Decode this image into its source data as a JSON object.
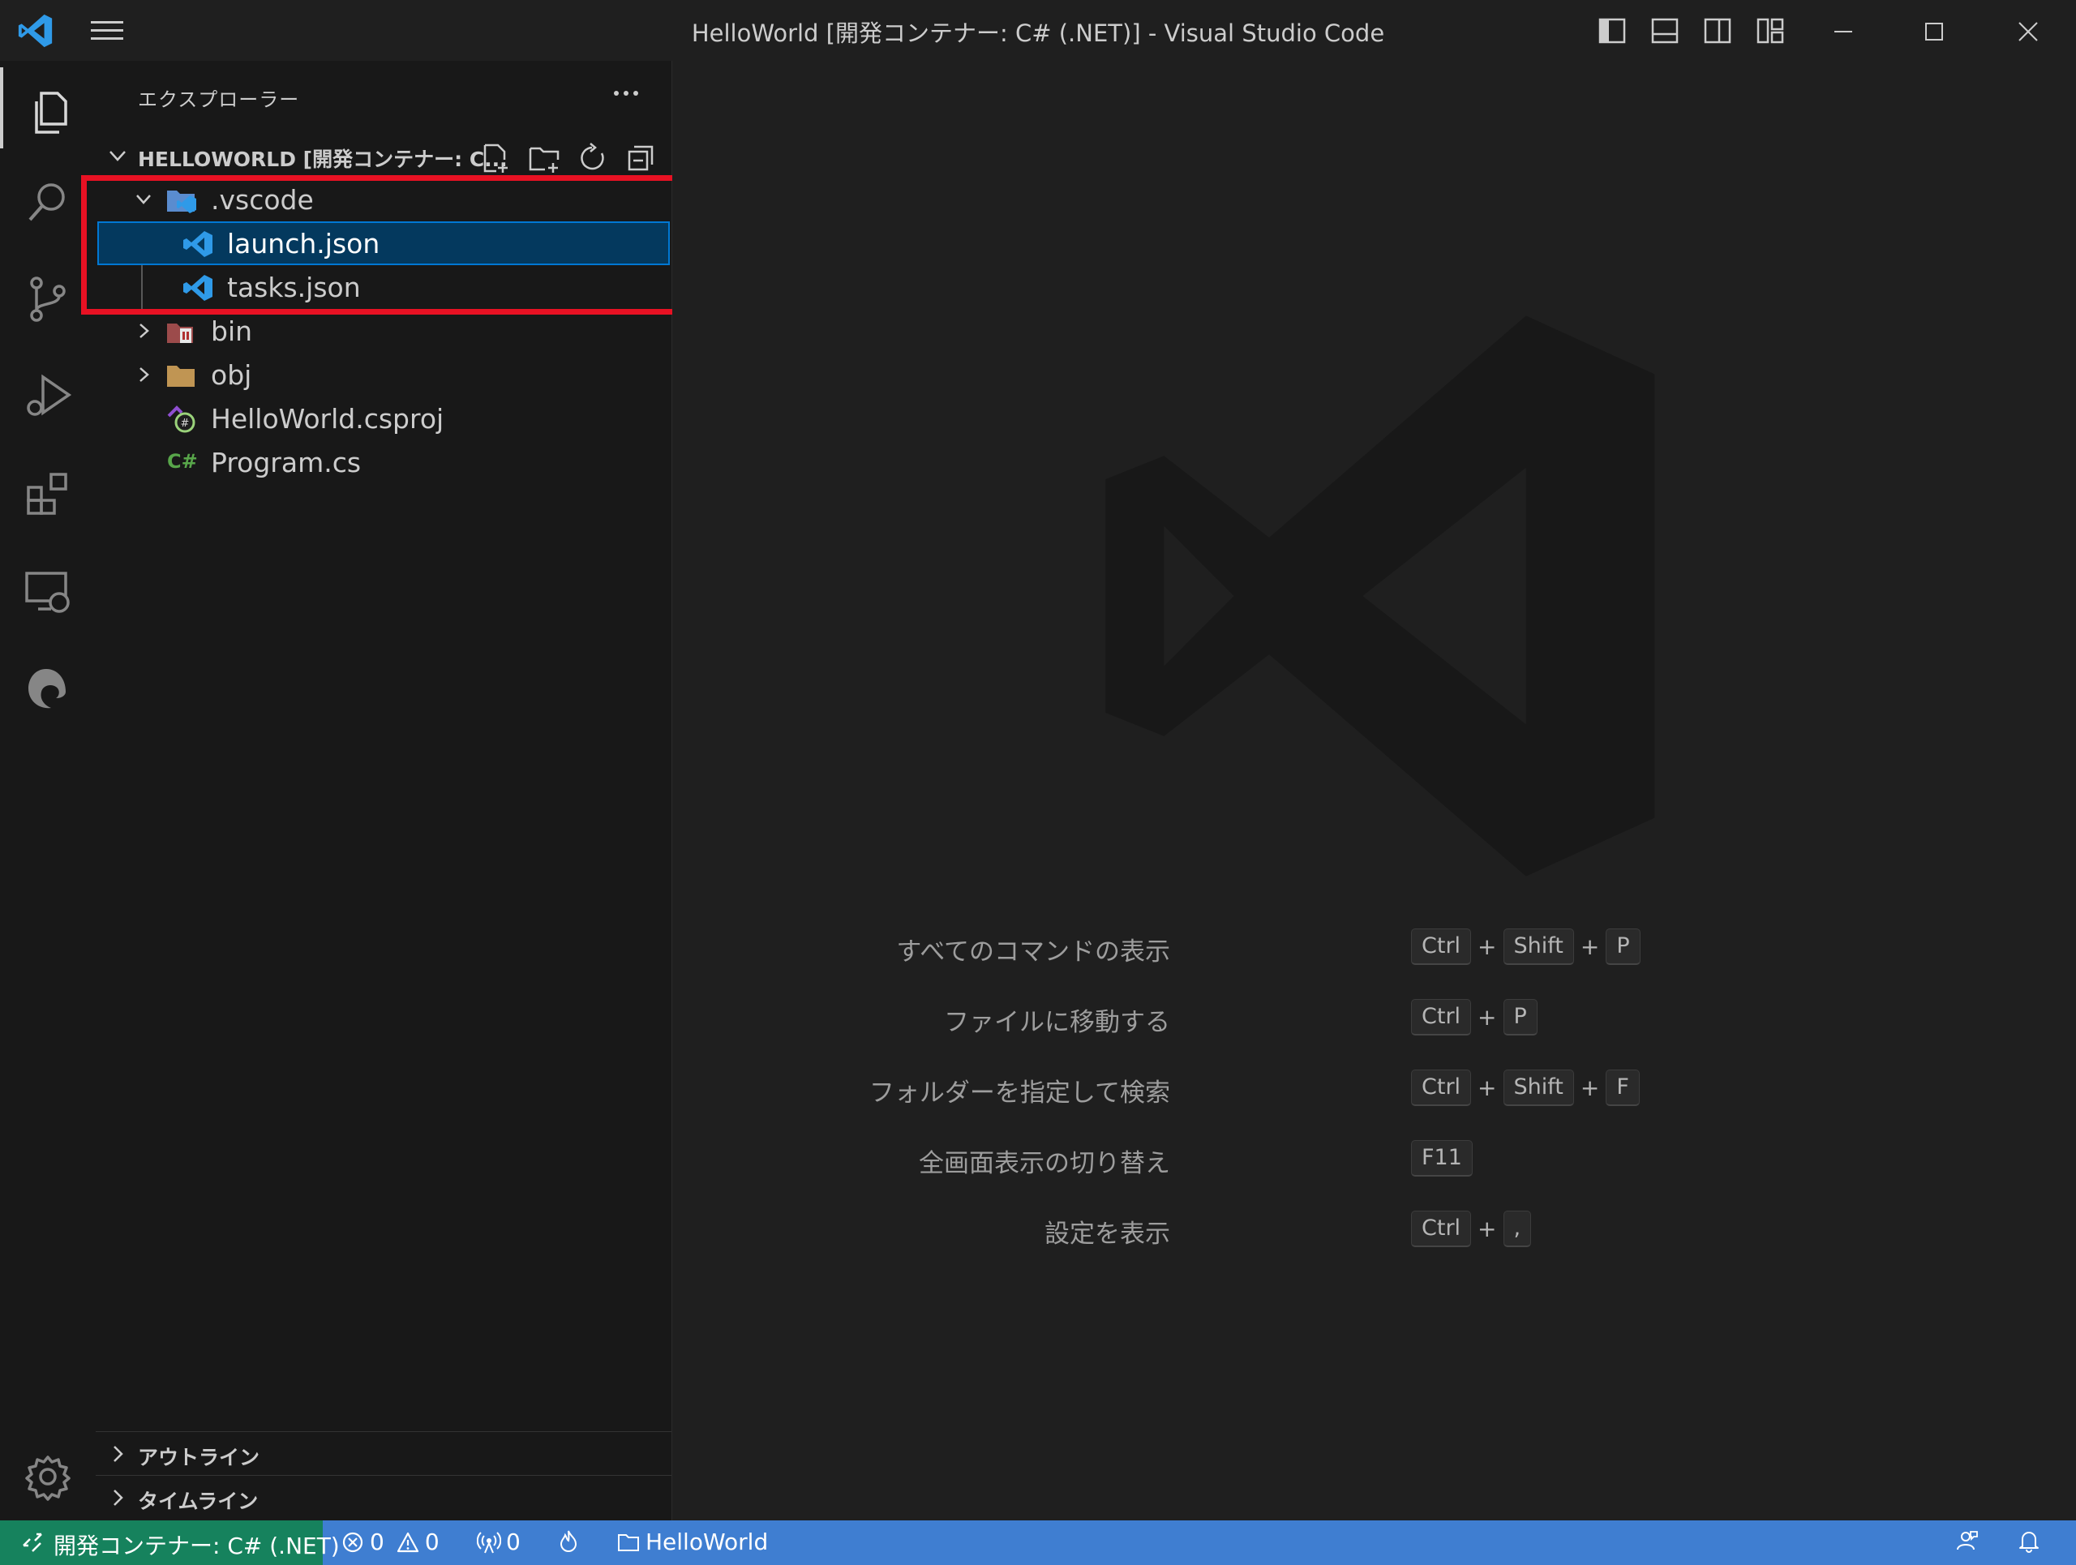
{
  "window": {
    "title": "HelloWorld [開発コンテナー: C# (.NET)] - Visual Studio Code"
  },
  "sidebar": {
    "header": "エクスプローラー",
    "section_title": "HELLOWORLD [開発コンテナー: C...",
    "tree": [
      {
        "name": ".vscode",
        "type": "folder",
        "expanded": true,
        "icon": "vscode-folder-icon"
      },
      {
        "name": "launch.json",
        "type": "file",
        "selected": true,
        "icon": "vscode-file-icon"
      },
      {
        "name": "tasks.json",
        "type": "file",
        "icon": "vscode-file-icon"
      },
      {
        "name": "bin",
        "type": "folder",
        "expanded": false,
        "icon": "bin-folder-icon"
      },
      {
        "name": "obj",
        "type": "folder",
        "expanded": false,
        "icon": "folder-icon"
      },
      {
        "name": "HelloWorld.csproj",
        "type": "file",
        "icon": "csproj-icon"
      },
      {
        "name": "Program.cs",
        "type": "file",
        "icon": "csharp-icon"
      }
    ],
    "csharp_badge": "C#",
    "outline_label": "アウトライン",
    "timeline_label": "タイムライン"
  },
  "editor": {
    "shortcuts": [
      {
        "label": "すべてのコマンドの表示",
        "keys": [
          "Ctrl",
          "Shift",
          "P"
        ]
      },
      {
        "label": "ファイルに移動する",
        "keys": [
          "Ctrl",
          "P"
        ]
      },
      {
        "label": "フォルダーを指定して検索",
        "keys": [
          "Ctrl",
          "Shift",
          "F"
        ]
      },
      {
        "label": "全画面表示の切り替え",
        "keys": [
          "F11"
        ]
      },
      {
        "label": "設定を表示",
        "keys": [
          "Ctrl",
          ","
        ]
      }
    ],
    "key_separator": "+"
  },
  "status": {
    "remote_label": "開発コンテナー: C# (.NET)",
    "errors": "0",
    "warnings": "0",
    "ports": "0",
    "folder": "HelloWorld"
  },
  "colors": {
    "accent": "#0078d4",
    "statusbar": "#3f7ed1",
    "remote": "#16825d",
    "highlight_box": "#e81123"
  }
}
